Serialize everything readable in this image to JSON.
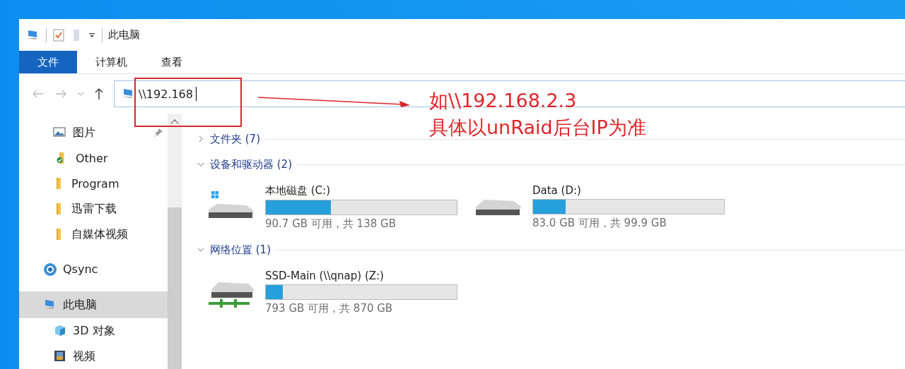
{
  "window": {
    "title": "此电脑"
  },
  "ribbon_tabs": [
    {
      "label": "文件",
      "selected": true
    },
    {
      "label": "计算机",
      "selected": false
    },
    {
      "label": "查看",
      "selected": false
    }
  ],
  "address": {
    "value": "\\\\192.168"
  },
  "nav_pane": [
    {
      "items": [
        {
          "kind": "pictures",
          "label": "图片",
          "pinned": true,
          "selected": false
        },
        {
          "kind": "synced-folder",
          "label": "Other",
          "pinned": false,
          "selected": false
        },
        {
          "kind": "folder",
          "label": "Program",
          "pinned": false,
          "selected": false
        },
        {
          "kind": "folder",
          "label": "迅雷下载",
          "pinned": false,
          "selected": false
        },
        {
          "kind": "folder",
          "label": "自媒体视频",
          "pinned": false,
          "selected": false
        }
      ]
    },
    {
      "items": [
        {
          "kind": "qsync",
          "label": "Qsync",
          "pinned": false,
          "selected": false
        }
      ]
    },
    {
      "items": [
        {
          "kind": "pc",
          "label": "此电脑",
          "pinned": false,
          "selected": true,
          "children": [
            {
              "kind": "cube",
              "label": "3D 对象",
              "pinned": false,
              "selected": false
            },
            {
              "kind": "video",
              "label": "视频",
              "pinned": false,
              "selected": false
            }
          ]
        }
      ]
    }
  ],
  "groups": [
    {
      "title": "文件夹 (7)",
      "expanded": false
    },
    {
      "title": "设备和驱动器 (2)",
      "expanded": true,
      "drives": [
        {
          "kind": "system-disk",
          "name": "本地磁盘 (C:)",
          "level": 0.34,
          "info": "90.7 GB 可用，共 138 GB"
        },
        {
          "kind": "disk",
          "name": "Data (D:)",
          "level": 0.17,
          "info": "83.0 GB 可用，共 99.9 GB"
        }
      ]
    },
    {
      "title": "网络位置 (1)",
      "expanded": true,
      "drives": [
        {
          "kind": "network-disk",
          "name": "SSD-Main (\\\\qnap) (Z:)",
          "level": 0.09,
          "info": "793 GB 可用，共 870 GB"
        }
      ]
    }
  ],
  "annotation": {
    "lines": [
      "如\\\\192.168.2.3",
      "具体以unRaid后台IP为准"
    ]
  }
}
